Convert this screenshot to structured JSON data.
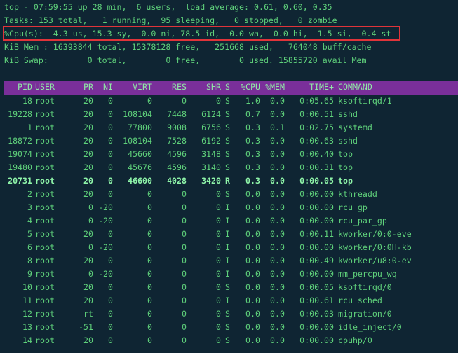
{
  "summary": {
    "line1": "top - 07:59:55 up 28 min,  6 users,  load average: 0.61, 0.60, 0.35",
    "line2": "Tasks: 153 total,   1 running,  95 sleeping,   0 stopped,   0 zombie",
    "line3": "%Cpu(s):  4.3 us, 15.3 sy,  0.0 ni, 78.5 id,  0.0 wa,  0.0 hi,  1.5 si,  0.4 st",
    "line4": "KiB Mem : 16393844 total, 15378128 free,   251668 used,   764048 buff/cache",
    "line5": "KiB Swap:        0 total,        0 free,        0 used. 15855720 avail Mem"
  },
  "columns": [
    "PID",
    "USER",
    "PR",
    "NI",
    "VIRT",
    "RES",
    "SHR",
    "S",
    "%CPU",
    "%MEM",
    "TIME+",
    "COMMAND"
  ],
  "processes": [
    [
      "18",
      "root",
      "20",
      "0",
      "0",
      "0",
      "0",
      "S",
      "1.0",
      "0.0",
      "0:05.65",
      "ksoftirqd/1"
    ],
    [
      "19228",
      "root",
      "20",
      "0",
      "108104",
      "7448",
      "6124",
      "S",
      "0.7",
      "0.0",
      "0:00.51",
      "sshd"
    ],
    [
      "1",
      "root",
      "20",
      "0",
      "77800",
      "9008",
      "6756",
      "S",
      "0.3",
      "0.1",
      "0:02.75",
      "systemd"
    ],
    [
      "18872",
      "root",
      "20",
      "0",
      "108104",
      "7528",
      "6192",
      "S",
      "0.3",
      "0.0",
      "0:00.63",
      "sshd"
    ],
    [
      "19074",
      "root",
      "20",
      "0",
      "45660",
      "4596",
      "3148",
      "S",
      "0.3",
      "0.0",
      "0:00.40",
      "top"
    ],
    [
      "19480",
      "root",
      "20",
      "0",
      "45676",
      "4596",
      "3140",
      "S",
      "0.3",
      "0.0",
      "0:00.31",
      "top"
    ],
    [
      "20731",
      "root",
      "20",
      "0",
      "46600",
      "4028",
      "3420",
      "R",
      "0.3",
      "0.0",
      "0:00.05",
      "top"
    ],
    [
      "2",
      "root",
      "20",
      "0",
      "0",
      "0",
      "0",
      "S",
      "0.0",
      "0.0",
      "0:00.00",
      "kthreadd"
    ],
    [
      "3",
      "root",
      "0",
      "-20",
      "0",
      "0",
      "0",
      "I",
      "0.0",
      "0.0",
      "0:00.00",
      "rcu_gp"
    ],
    [
      "4",
      "root",
      "0",
      "-20",
      "0",
      "0",
      "0",
      "I",
      "0.0",
      "0.0",
      "0:00.00",
      "rcu_par_gp"
    ],
    [
      "5",
      "root",
      "20",
      "0",
      "0",
      "0",
      "0",
      "I",
      "0.0",
      "0.0",
      "0:00.11",
      "kworker/0:0-eve"
    ],
    [
      "6",
      "root",
      "0",
      "-20",
      "0",
      "0",
      "0",
      "I",
      "0.0",
      "0.0",
      "0:00.00",
      "kworker/0:0H-kb"
    ],
    [
      "8",
      "root",
      "20",
      "0",
      "0",
      "0",
      "0",
      "I",
      "0.0",
      "0.0",
      "0:00.49",
      "kworker/u8:0-ev"
    ],
    [
      "9",
      "root",
      "0",
      "-20",
      "0",
      "0",
      "0",
      "I",
      "0.0",
      "0.0",
      "0:00.00",
      "mm_percpu_wq"
    ],
    [
      "10",
      "root",
      "20",
      "0",
      "0",
      "0",
      "0",
      "S",
      "0.0",
      "0.0",
      "0:00.05",
      "ksoftirqd/0"
    ],
    [
      "11",
      "root",
      "20",
      "0",
      "0",
      "0",
      "0",
      "I",
      "0.0",
      "0.0",
      "0:00.61",
      "rcu_sched"
    ],
    [
      "12",
      "root",
      "rt",
      "0",
      "0",
      "0",
      "0",
      "S",
      "0.0",
      "0.0",
      "0:00.03",
      "migration/0"
    ],
    [
      "13",
      "root",
      "-51",
      "0",
      "0",
      "0",
      "0",
      "S",
      "0.0",
      "0.0",
      "0:00.00",
      "idle_inject/0"
    ],
    [
      "14",
      "root",
      "20",
      "0",
      "0",
      "0",
      "0",
      "S",
      "0.0",
      "0.0",
      "0:00.00",
      "cpuhp/0"
    ]
  ],
  "highlighted_row_pid": "20731",
  "colors": {
    "background": "#0f2533",
    "text": "#5fd17b",
    "header_bar": "#7a2f9a",
    "highlight_border": "#e0343a"
  }
}
